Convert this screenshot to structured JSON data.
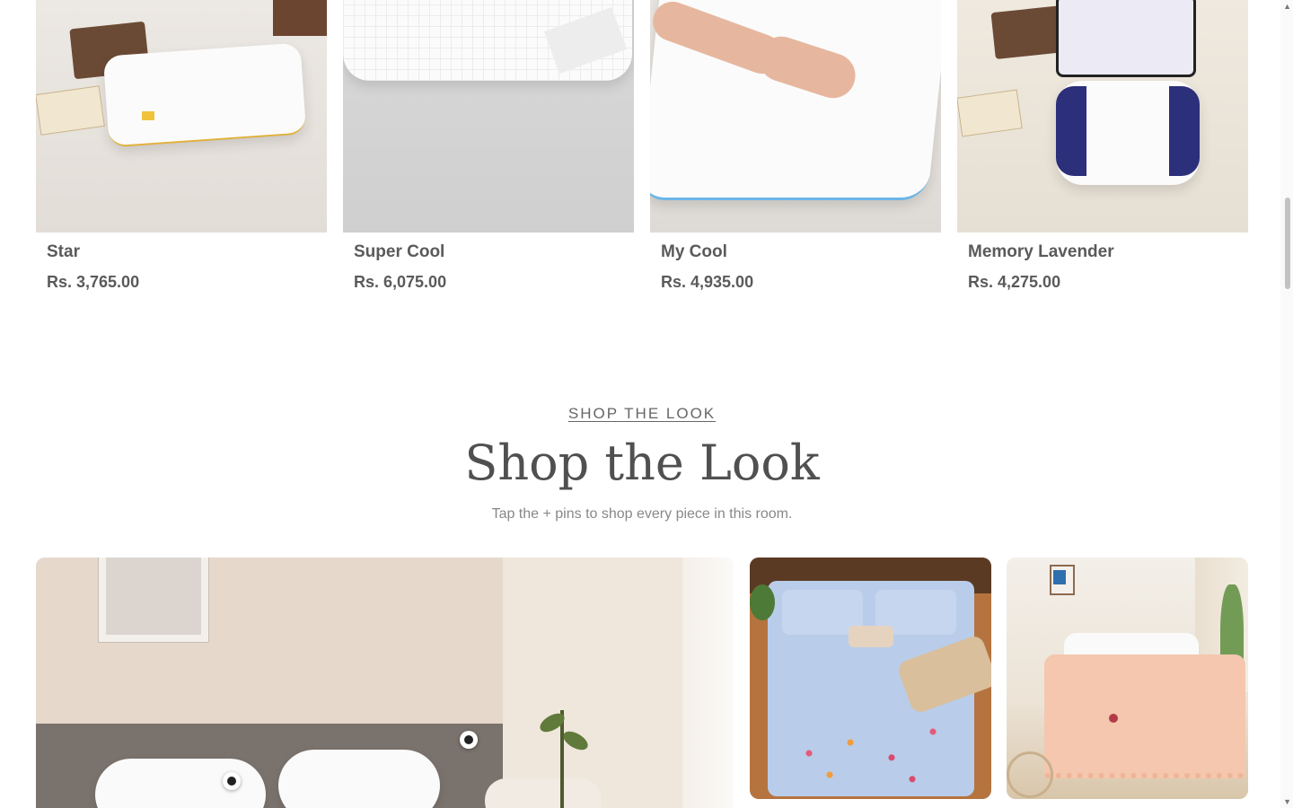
{
  "products": [
    {
      "name": "Star",
      "price": "Rs. 3,765.00"
    },
    {
      "name": "Super Cool",
      "price": "Rs. 6,075.00"
    },
    {
      "name": "My Cool",
      "price": "Rs. 4,935.00"
    },
    {
      "name": "Memory Lavender",
      "price": "Rs. 4,275.00"
    }
  ],
  "shop_look": {
    "eyebrow": "SHOP THE LOOK",
    "title": "Shop the Look",
    "subtitle": "Tap the + pins to shop every piece in this room."
  },
  "scrollbar": {
    "up_arrow": "▲",
    "down_arrow": "▼"
  }
}
